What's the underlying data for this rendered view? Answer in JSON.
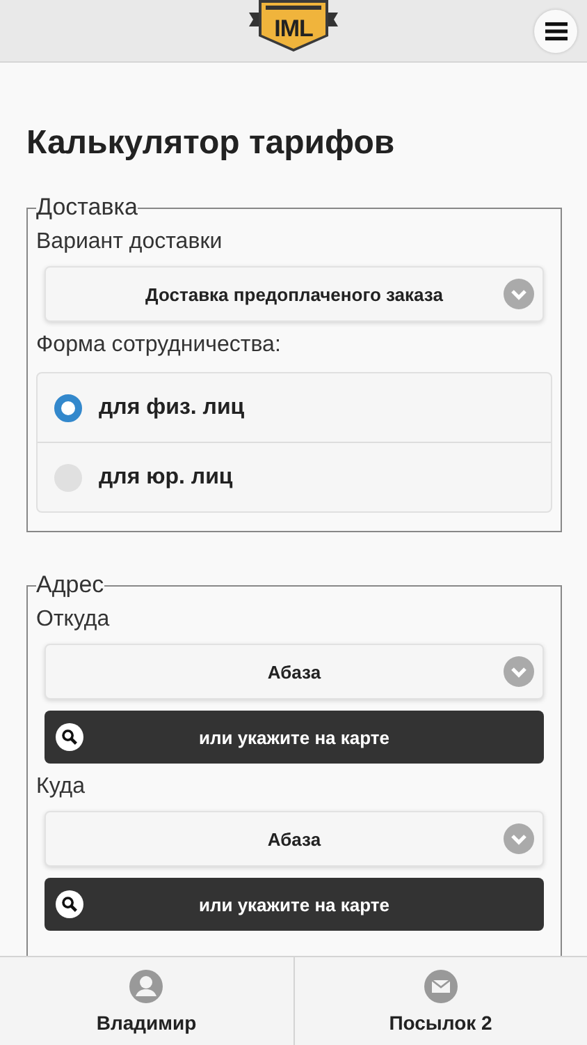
{
  "header": {
    "logo_text": "IML"
  },
  "title": "Калькулятор тарифов",
  "delivery": {
    "legend": "Доставка",
    "variant_label": "Вариант доставки",
    "variant_value": "Доставка предоплаченого заказа",
    "form_label": "Форма сотрудничества:",
    "options": [
      {
        "label": "для физ. лиц",
        "selected": true
      },
      {
        "label": "для юр. лиц",
        "selected": false
      }
    ]
  },
  "address": {
    "legend": "Адрес",
    "groups": [
      {
        "label": "Откуда",
        "value": "Абаза",
        "map_button": "или укажите на карте"
      },
      {
        "label": "Куда",
        "value": "Абаза",
        "map_button": "или укажите на карте"
      }
    ]
  },
  "footer": [
    {
      "kind": "user",
      "label": "Владимир"
    },
    {
      "kind": "mail",
      "label": "Посылок 2"
    }
  ]
}
